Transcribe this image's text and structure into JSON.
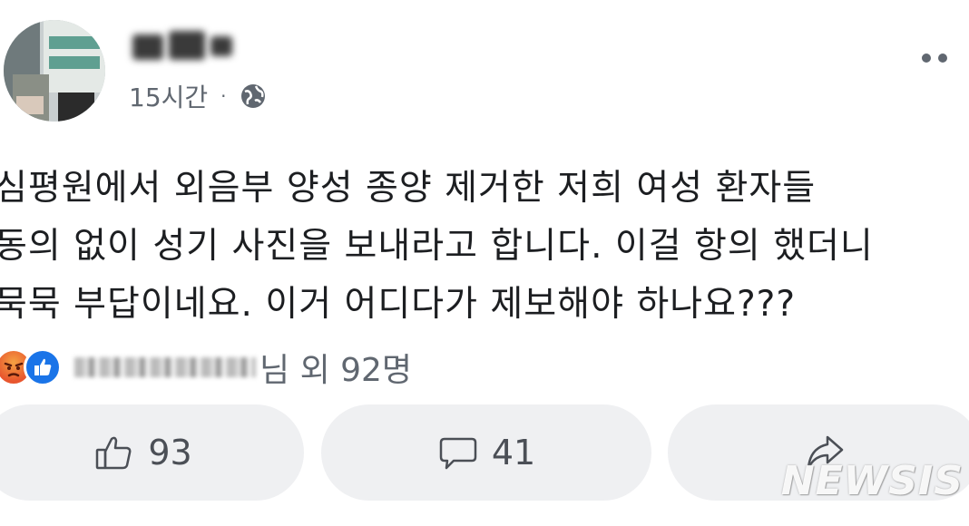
{
  "post": {
    "time": "15시간",
    "separator": "·",
    "body_lines": [
      "심평원에서 외음부 양성 종양 제거한 저희 여성 환자들",
      "동의 없이 성기 사진을 보내라고 합니다. 이걸 항의 했더니",
      "묵묵 부답이네요. 이거 어디다가 제보해야 하나요???"
    ]
  },
  "reactions": {
    "summary_text": "님 외 92명",
    "icons": [
      "angry-icon",
      "like-icon"
    ]
  },
  "actions": {
    "like_count": "93",
    "comment_count": "41"
  },
  "watermark": "NEWSIS",
  "colors": {
    "secondary_text": "#606770",
    "button_bg": "#eff0f2",
    "like_blue": "#1a74e8"
  }
}
